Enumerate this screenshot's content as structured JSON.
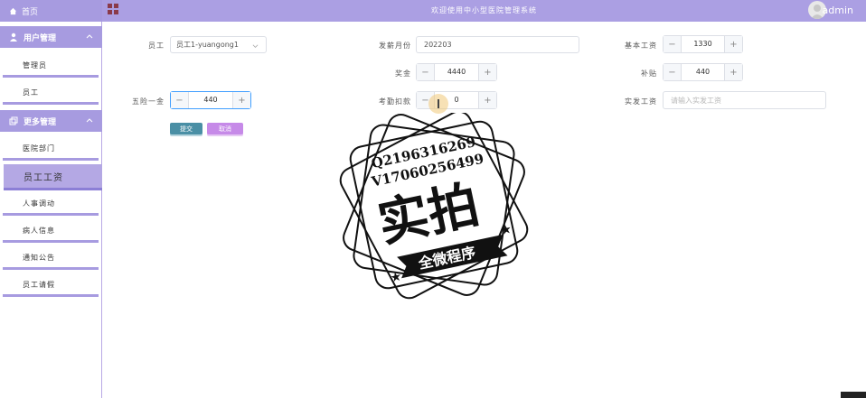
{
  "header": {
    "title": "欢迎使用中小型医院管理系统",
    "username": "admin"
  },
  "sidebar": {
    "home": "首页",
    "groups": [
      {
        "label": "用户管理",
        "items": [
          "管理员",
          "员工"
        ]
      },
      {
        "label": "更多管理",
        "items": [
          "医院部门",
          "员工工资",
          "人事调动",
          "病人信息",
          "通知公告",
          "员工请假"
        ]
      }
    ],
    "active_item": "员工工资"
  },
  "form": {
    "employee": {
      "label": "员工",
      "value": "员工1-yuangong1"
    },
    "month": {
      "label": "发薪月份",
      "value": "202203"
    },
    "base_salary": {
      "label": "基本工资",
      "value": "1330"
    },
    "bonus": {
      "label": "奖金",
      "value": "4440"
    },
    "allowance": {
      "label": "补贴",
      "value": "440"
    },
    "insurance": {
      "label": "五险一金",
      "value": "440"
    },
    "deduction": {
      "label": "考勤扣款",
      "value": "0"
    },
    "net_pay": {
      "label": "实发工资",
      "placeholder": "请输入实发工资"
    },
    "submit_label": "提交",
    "cancel_label": "取消",
    "minus": "−",
    "plus": "+"
  },
  "watermark": {
    "line1": "Q2196316269",
    "line2": "V17060256499",
    "main": "实拍",
    "banner": "全微程序"
  },
  "colors": {
    "sidebar_accent": "#a79be0",
    "topbar": "#ab9fe3",
    "submit": "#4a8fa5",
    "cancel": "#c68ae8"
  }
}
